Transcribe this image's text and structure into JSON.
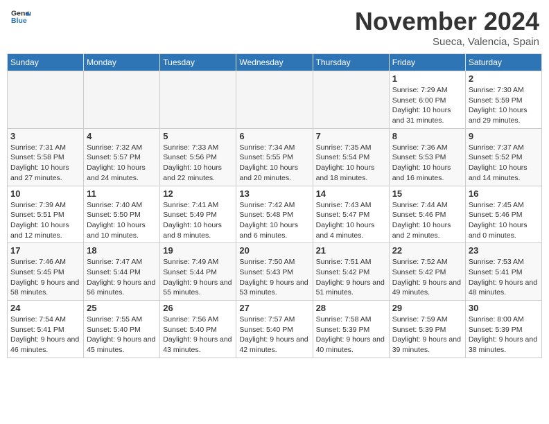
{
  "header": {
    "logo_general": "General",
    "logo_blue": "Blue",
    "month_title": "November 2024",
    "location": "Sueca, Valencia, Spain"
  },
  "weekdays": [
    "Sunday",
    "Monday",
    "Tuesday",
    "Wednesday",
    "Thursday",
    "Friday",
    "Saturday"
  ],
  "weeks": [
    [
      {
        "day": "",
        "empty": true
      },
      {
        "day": "",
        "empty": true
      },
      {
        "day": "",
        "empty": true
      },
      {
        "day": "",
        "empty": true
      },
      {
        "day": "",
        "empty": true
      },
      {
        "day": "1",
        "sunrise": "Sunrise: 7:29 AM",
        "sunset": "Sunset: 6:00 PM",
        "daylight": "Daylight: 10 hours and 31 minutes."
      },
      {
        "day": "2",
        "sunrise": "Sunrise: 7:30 AM",
        "sunset": "Sunset: 5:59 PM",
        "daylight": "Daylight: 10 hours and 29 minutes."
      }
    ],
    [
      {
        "day": "3",
        "sunrise": "Sunrise: 7:31 AM",
        "sunset": "Sunset: 5:58 PM",
        "daylight": "Daylight: 10 hours and 27 minutes."
      },
      {
        "day": "4",
        "sunrise": "Sunrise: 7:32 AM",
        "sunset": "Sunset: 5:57 PM",
        "daylight": "Daylight: 10 hours and 24 minutes."
      },
      {
        "day": "5",
        "sunrise": "Sunrise: 7:33 AM",
        "sunset": "Sunset: 5:56 PM",
        "daylight": "Daylight: 10 hours and 22 minutes."
      },
      {
        "day": "6",
        "sunrise": "Sunrise: 7:34 AM",
        "sunset": "Sunset: 5:55 PM",
        "daylight": "Daylight: 10 hours and 20 minutes."
      },
      {
        "day": "7",
        "sunrise": "Sunrise: 7:35 AM",
        "sunset": "Sunset: 5:54 PM",
        "daylight": "Daylight: 10 hours and 18 minutes."
      },
      {
        "day": "8",
        "sunrise": "Sunrise: 7:36 AM",
        "sunset": "Sunset: 5:53 PM",
        "daylight": "Daylight: 10 hours and 16 minutes."
      },
      {
        "day": "9",
        "sunrise": "Sunrise: 7:37 AM",
        "sunset": "Sunset: 5:52 PM",
        "daylight": "Daylight: 10 hours and 14 minutes."
      }
    ],
    [
      {
        "day": "10",
        "sunrise": "Sunrise: 7:39 AM",
        "sunset": "Sunset: 5:51 PM",
        "daylight": "Daylight: 10 hours and 12 minutes."
      },
      {
        "day": "11",
        "sunrise": "Sunrise: 7:40 AM",
        "sunset": "Sunset: 5:50 PM",
        "daylight": "Daylight: 10 hours and 10 minutes."
      },
      {
        "day": "12",
        "sunrise": "Sunrise: 7:41 AM",
        "sunset": "Sunset: 5:49 PM",
        "daylight": "Daylight: 10 hours and 8 minutes."
      },
      {
        "day": "13",
        "sunrise": "Sunrise: 7:42 AM",
        "sunset": "Sunset: 5:48 PM",
        "daylight": "Daylight: 10 hours and 6 minutes."
      },
      {
        "day": "14",
        "sunrise": "Sunrise: 7:43 AM",
        "sunset": "Sunset: 5:47 PM",
        "daylight": "Daylight: 10 hours and 4 minutes."
      },
      {
        "day": "15",
        "sunrise": "Sunrise: 7:44 AM",
        "sunset": "Sunset: 5:46 PM",
        "daylight": "Daylight: 10 hours and 2 minutes."
      },
      {
        "day": "16",
        "sunrise": "Sunrise: 7:45 AM",
        "sunset": "Sunset: 5:46 PM",
        "daylight": "Daylight: 10 hours and 0 minutes."
      }
    ],
    [
      {
        "day": "17",
        "sunrise": "Sunrise: 7:46 AM",
        "sunset": "Sunset: 5:45 PM",
        "daylight": "Daylight: 9 hours and 58 minutes."
      },
      {
        "day": "18",
        "sunrise": "Sunrise: 7:47 AM",
        "sunset": "Sunset: 5:44 PM",
        "daylight": "Daylight: 9 hours and 56 minutes."
      },
      {
        "day": "19",
        "sunrise": "Sunrise: 7:49 AM",
        "sunset": "Sunset: 5:44 PM",
        "daylight": "Daylight: 9 hours and 55 minutes."
      },
      {
        "day": "20",
        "sunrise": "Sunrise: 7:50 AM",
        "sunset": "Sunset: 5:43 PM",
        "daylight": "Daylight: 9 hours and 53 minutes."
      },
      {
        "day": "21",
        "sunrise": "Sunrise: 7:51 AM",
        "sunset": "Sunset: 5:42 PM",
        "daylight": "Daylight: 9 hours and 51 minutes."
      },
      {
        "day": "22",
        "sunrise": "Sunrise: 7:52 AM",
        "sunset": "Sunset: 5:42 PM",
        "daylight": "Daylight: 9 hours and 49 minutes."
      },
      {
        "day": "23",
        "sunrise": "Sunrise: 7:53 AM",
        "sunset": "Sunset: 5:41 PM",
        "daylight": "Daylight: 9 hours and 48 minutes."
      }
    ],
    [
      {
        "day": "24",
        "sunrise": "Sunrise: 7:54 AM",
        "sunset": "Sunset: 5:41 PM",
        "daylight": "Daylight: 9 hours and 46 minutes."
      },
      {
        "day": "25",
        "sunrise": "Sunrise: 7:55 AM",
        "sunset": "Sunset: 5:40 PM",
        "daylight": "Daylight: 9 hours and 45 minutes."
      },
      {
        "day": "26",
        "sunrise": "Sunrise: 7:56 AM",
        "sunset": "Sunset: 5:40 PM",
        "daylight": "Daylight: 9 hours and 43 minutes."
      },
      {
        "day": "27",
        "sunrise": "Sunrise: 7:57 AM",
        "sunset": "Sunset: 5:40 PM",
        "daylight": "Daylight: 9 hours and 42 minutes."
      },
      {
        "day": "28",
        "sunrise": "Sunrise: 7:58 AM",
        "sunset": "Sunset: 5:39 PM",
        "daylight": "Daylight: 9 hours and 40 minutes."
      },
      {
        "day": "29",
        "sunrise": "Sunrise: 7:59 AM",
        "sunset": "Sunset: 5:39 PM",
        "daylight": "Daylight: 9 hours and 39 minutes."
      },
      {
        "day": "30",
        "sunrise": "Sunrise: 8:00 AM",
        "sunset": "Sunset: 5:39 PM",
        "daylight": "Daylight: 9 hours and 38 minutes."
      }
    ]
  ]
}
